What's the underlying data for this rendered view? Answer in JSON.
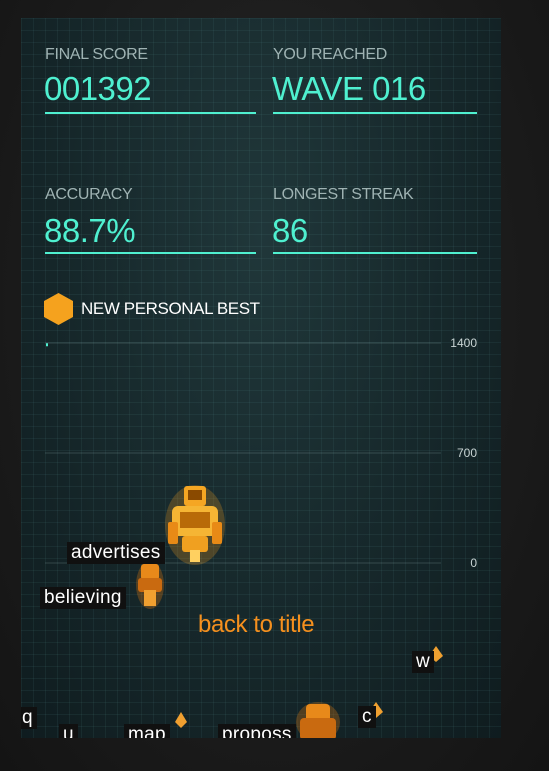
{
  "stats": {
    "final_score_label": "FINAL SCORE",
    "final_score_value": "001392",
    "wave_label": "YOU REACHED",
    "wave_value": "WAVE 016",
    "accuracy_label": "ACCURACY",
    "accuracy_value": "88.7%",
    "streak_label": "LONGEST STREAK",
    "streak_value": "86"
  },
  "personal_best": {
    "label": "NEW PERSONAL BEST",
    "icon": "hexagon-icon",
    "color": "#f5a21e"
  },
  "chart_data": {
    "type": "line",
    "x": [
      1
    ],
    "values": [
      1392
    ],
    "ylim": [
      0,
      1400
    ],
    "y_ticks": [
      "1400",
      "700",
      "0"
    ],
    "grid": true
  },
  "back_button": {
    "label": "back to title"
  },
  "enemy_words": [
    {
      "text": "advertises"
    },
    {
      "text": "believing"
    },
    {
      "text": "w"
    },
    {
      "text": "q"
    },
    {
      "text": "u"
    },
    {
      "text": "map"
    },
    {
      "text": "proposs"
    },
    {
      "text": "c"
    }
  ],
  "colors": {
    "accent": "#4ff0d0",
    "orange": "#f5901e",
    "panel": "#17292c"
  }
}
